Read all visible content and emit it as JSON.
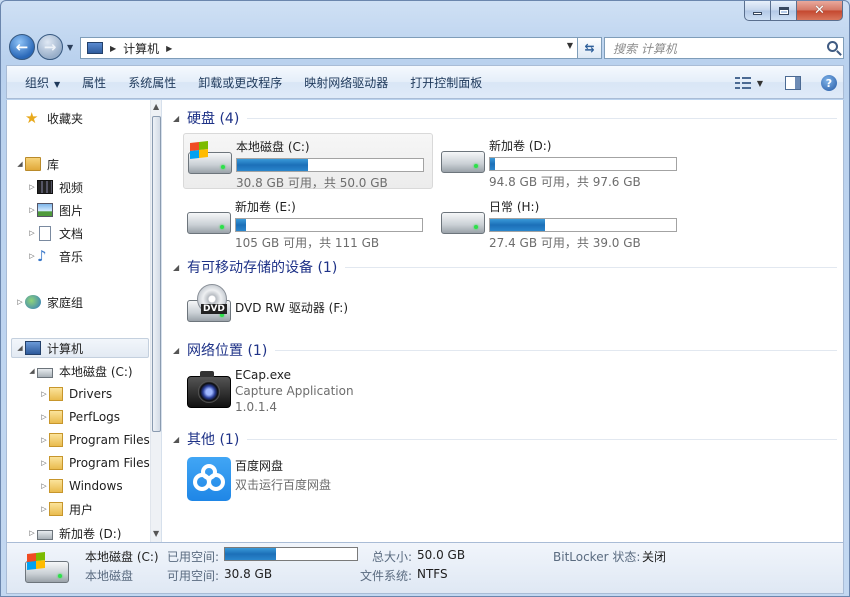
{
  "window": {
    "caption_buttons": {
      "minimize": "minimize",
      "maximize": "maximize",
      "close": "✕"
    }
  },
  "address": {
    "path": "计算机",
    "search_placeholder": "搜索 计算机"
  },
  "toolbar": {
    "items": [
      "组织",
      "属性",
      "系统属性",
      "卸载或更改程序",
      "映射网络驱动器",
      "打开控制面板"
    ],
    "help_label": "?"
  },
  "nav": {
    "favorites": "收藏夹",
    "libraries": "库",
    "library_items": [
      "视频",
      "图片",
      "文档",
      "音乐"
    ],
    "homegroup": "家庭组",
    "computer": "计算机",
    "local_disk": "本地磁盘 (C:)",
    "folders": [
      "Drivers",
      "PerfLogs",
      "Program Files",
      "Program Files",
      "Windows",
      "用户"
    ],
    "new_volume": "新加卷 (D:)"
  },
  "groups": {
    "hard_disks": "硬盘 (4)",
    "removable": "有可移动存储的设备 (1)",
    "network": "网络位置 (1)",
    "other": "其他 (1)"
  },
  "drives": [
    {
      "name": "本地磁盘 (C:)",
      "info": "30.8 GB 可用，共 50.0 GB",
      "used_fraction": 0.384
    },
    {
      "name": "新加卷 (D:)",
      "info": "94.8 GB 可用，共 97.6 GB",
      "used_fraction": 0.029
    },
    {
      "name": "新加卷 (E:)",
      "info": "105 GB 可用，共 111 GB",
      "used_fraction": 0.054
    },
    {
      "name": "日常 (H:)",
      "info": "27.4 GB 可用，共 39.0 GB",
      "used_fraction": 0.297
    }
  ],
  "removable": {
    "name": "DVD RW 驱动器 (F:)",
    "icon_text": "DVD"
  },
  "network_item": {
    "name": "ECap.exe",
    "desc": "Capture Application",
    "version": "1.0.1.4"
  },
  "other_item": {
    "name": "百度网盘",
    "desc": "双击运行百度网盘"
  },
  "details": {
    "title": "本地磁盘 (C:)",
    "type": "本地磁盘",
    "used_label": "已用空间:",
    "used_fraction": 0.384,
    "free_label": "可用空间:",
    "free_value": "30.8 GB",
    "total_label": "总大小:",
    "total_value": "50.0 GB",
    "fs_label": "文件系统:",
    "fs_value": "NTFS",
    "bitlocker_label": "BitLocker 状态:",
    "bitlocker_value": "关闭"
  },
  "colors": {
    "accent": "#1e3287",
    "bar_fill": "#1c6fb8"
  }
}
